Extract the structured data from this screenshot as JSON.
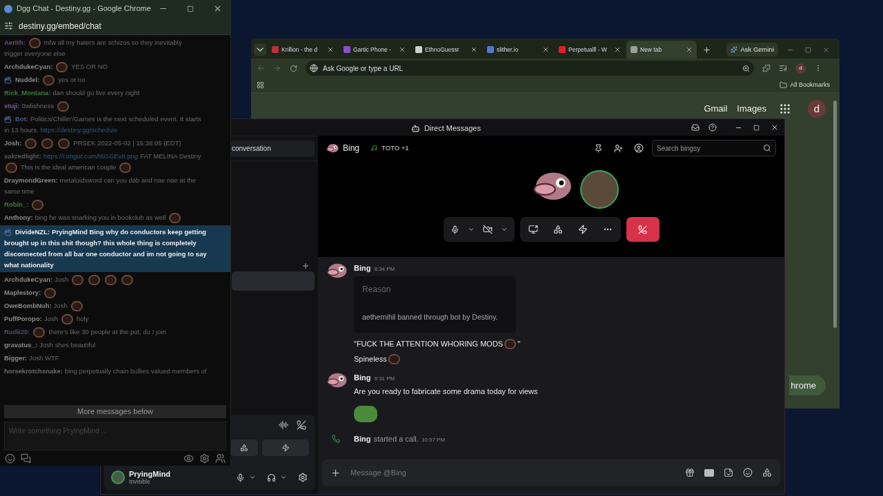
{
  "dgg_chat": {
    "title": "Dgg Chat - Destiny.gg - Google Chrome",
    "url": "destiny.gg/embed/chat",
    "messages": [
      {
        "user": "Aerith:",
        "color": "#6a4f8a",
        "badge": false,
        "highlighted": false,
        "lines": [
          [
            {
              "kind": "emote"
            },
            {
              "kind": "text",
              "text": "mfw all my haters are schizos so they inevitably"
            }
          ],
          [
            {
              "kind": "text",
              "text": "trigger everyone else"
            }
          ]
        ]
      },
      {
        "user": "ArchdukeCyan:",
        "color": "#8a8a8a",
        "badge": false,
        "highlighted": false,
        "lines": [
          [
            {
              "kind": "emote"
            },
            {
              "kind": "text",
              "text": "YES OR NO"
            }
          ]
        ]
      },
      {
        "user": "Nuddel:",
        "color": "#8a8a8a",
        "badge": true,
        "highlighted": false,
        "lines": [
          [
            {
              "kind": "emote"
            },
            {
              "kind": "text",
              "text": "yes or no"
            }
          ]
        ]
      },
      {
        "user": "Rick_Montana:",
        "color": "#3f7a3a",
        "badge": false,
        "highlighted": false,
        "lines": [
          [
            {
              "kind": "text",
              "text": "dan should go live every night"
            }
          ]
        ]
      },
      {
        "user": "stuji:",
        "color": "#7a5a9a",
        "badge": false,
        "highlighted": false,
        "lines": [
          [
            {
              "kind": "text",
              "text": "0wlishness"
            },
            {
              "kind": "emote"
            }
          ]
        ]
      },
      {
        "user": "Bot:",
        "color": "#4a5a8a",
        "badge": true,
        "highlighted": false,
        "lines": [
          [
            {
              "kind": "text",
              "text": "Politics/Chillin'/Games is the next scheduled event. It starts"
            }
          ],
          [
            {
              "kind": "text",
              "text": "in 13 hours."
            },
            {
              "kind": "link",
              "text": "https://destiny.gg/schedule"
            }
          ]
        ]
      },
      {
        "user": "Josh:",
        "color": "#8a8a8a",
        "badge": false,
        "highlighted": false,
        "lines": [
          [
            {
              "kind": "emote"
            },
            {
              "kind": "emote"
            },
            {
              "kind": "emote"
            },
            {
              "kind": "text",
              "text": "PRSEK 2022-05-02 | 15:38:05 (EDT)"
            }
          ]
        ]
      },
      {
        "user": "sakredlight:",
        "color": "#5a5a5a",
        "badge": false,
        "highlighted": false,
        "lines": [
          [
            {
              "kind": "link",
              "text": "https://i.imgur.com/t6GGEv8.png"
            },
            {
              "kind": "text",
              "text": "FAT MELINA Destiny"
            }
          ],
          [
            {
              "kind": "emote"
            },
            {
              "kind": "text",
              "text": "This is the ideal american couple"
            },
            {
              "kind": "emote"
            }
          ]
        ]
      },
      {
        "user": "DraymondGreen:",
        "color": "#8a8a8a",
        "badge": false,
        "highlighted": false,
        "lines": [
          [
            {
              "kind": "text",
              "text": "metaloidsword can you dab and nae nae at the"
            }
          ],
          [
            {
              "kind": "text",
              "text": "same time"
            }
          ]
        ]
      },
      {
        "user": "Robin_:",
        "color": "#3f7a3a",
        "badge": false,
        "highlighted": false,
        "lines": [
          [
            {
              "kind": "emote"
            }
          ]
        ]
      },
      {
        "user": "Anthony:",
        "color": "#8a8a8a",
        "badge": false,
        "highlighted": false,
        "lines": [
          [
            {
              "kind": "text",
              "text": "bing he was snarking you in bookclub as well"
            },
            {
              "kind": "emote"
            }
          ]
        ]
      },
      {
        "user": "DivideNZL:",
        "color": "#e8eef4",
        "badge": true,
        "highlighted": true,
        "lines": [
          [
            {
              "kind": "text",
              "text": "PryingMind Bing why do conductors keep getting"
            }
          ],
          [
            {
              "kind": "text",
              "text": "brought up in this shit though? this whole thing is completely"
            }
          ],
          [
            {
              "kind": "text",
              "text": "disconnected from all bar one conductor and im not going to say"
            }
          ],
          [
            {
              "kind": "text",
              "text": "what nationality"
            }
          ]
        ]
      },
      {
        "user": "ArchdukeCyan:",
        "color": "#8a8a8a",
        "badge": false,
        "highlighted": false,
        "lines": [
          [
            {
              "kind": "text",
              "text": "Josh"
            },
            {
              "kind": "emote"
            },
            {
              "kind": "emote"
            },
            {
              "kind": "emote"
            },
            {
              "kind": "emote"
            }
          ]
        ]
      },
      {
        "user": "Maplestory:",
        "color": "#8a8a8a",
        "badge": false,
        "highlighted": false,
        "lines": [
          [
            {
              "kind": "emote"
            }
          ]
        ]
      },
      {
        "user": "OweBombNuh:",
        "color": "#8a8a8a",
        "badge": false,
        "highlighted": false,
        "lines": [
          [
            {
              "kind": "text",
              "text": "Josh"
            },
            {
              "kind": "emote"
            }
          ]
        ]
      },
      {
        "user": "PuffPoropo:",
        "color": "#8a8a8a",
        "badge": false,
        "highlighted": false,
        "lines": [
          [
            {
              "kind": "text",
              "text": "Josh"
            },
            {
              "kind": "emote"
            },
            {
              "kind": "text",
              "text": "holy"
            }
          ]
        ]
      },
      {
        "user": "Rudii20:",
        "color": "#4a4a7a",
        "badge": false,
        "highlighted": false,
        "lines": [
          [
            {
              "kind": "emote"
            },
            {
              "kind": "text",
              "text": "there's like 30 people at the pot, do I join"
            }
          ]
        ]
      },
      {
        "user": "gravatus_:",
        "color": "#8a8a8a",
        "badge": false,
        "highlighted": false,
        "lines": [
          [
            {
              "kind": "text",
              "text": "Josh shes beautiful"
            }
          ]
        ]
      },
      {
        "user": "Bigger:",
        "color": "#8a8a8a",
        "badge": false,
        "highlighted": false,
        "lines": [
          [
            {
              "kind": "text",
              "text": "Josh WTF"
            }
          ]
        ]
      },
      {
        "user": "horsekrotchsnake:",
        "color": "#6a6a6a",
        "badge": false,
        "highlighted": false,
        "lines": [
          [
            {
              "kind": "text",
              "text": "bing perpetually chain bullies valued members of"
            }
          ]
        ]
      }
    ],
    "more_messages": "More messages below",
    "input_placeholder": "Write something PryingMind ..."
  },
  "chrome": {
    "tabs": [
      {
        "label": "Krillion - the d",
        "color": "#c0303a",
        "selected": false
      },
      {
        "label": "Gartic Phone -",
        "color": "#8a4fd0",
        "selected": false
      },
      {
        "label": "EthnoGuessr",
        "color": "#d0d0d0",
        "selected": false
      },
      {
        "label": "slither.io",
        "color": "#4a7ad0",
        "selected": false
      },
      {
        "label": "Perpetualll - W",
        "color": "#e02020",
        "selected": false
      },
      {
        "label": "New tab",
        "color": "#9aa09a",
        "selected": true
      }
    ],
    "gemini": "Ask Gemini",
    "omnibox_placeholder": "Ask Google or type a URL",
    "profile": "d",
    "all_bookmarks": "All Bookmarks",
    "links": [
      "Gmail",
      "Images"
    ],
    "account": "d",
    "chrome_button": "hrome"
  },
  "discord": {
    "title": "Direct Messages",
    "find_conversation": "conversation",
    "user": {
      "name": "PryingMind",
      "status": "Invisible"
    },
    "header": {
      "name": "Bing",
      "activity": "TOTO +1",
      "search_placeholder": "Search bingsy"
    },
    "messages": [
      {
        "kind": "message",
        "author": "Bing",
        "time": "8:34 PM",
        "embed": {
          "title": "Reason",
          "body": "aethernihil banned through bot by Destiny."
        },
        "lines": [
          [
            {
              "kind": "text",
              "text": "\"FUCK THE ATTENTION WHORING MODS"
            },
            {
              "kind": "emote"
            },
            {
              "kind": "text",
              "text": "\""
            }
          ],
          [
            {
              "kind": "text",
              "text": "Spineless"
            },
            {
              "kind": "emote"
            }
          ]
        ],
        "big_emote": false
      },
      {
        "kind": "message",
        "author": "Bing",
        "time": "9:31 PM",
        "lines": [
          [
            {
              "kind": "text",
              "text": "Are you ready to fabricate some drama today for views"
            }
          ]
        ],
        "big_emote": true
      },
      {
        "kind": "call",
        "author": "Bing",
        "text": "started a call.",
        "time": "10:07 PM"
      }
    ],
    "composer_placeholder": "Message @Bing"
  }
}
